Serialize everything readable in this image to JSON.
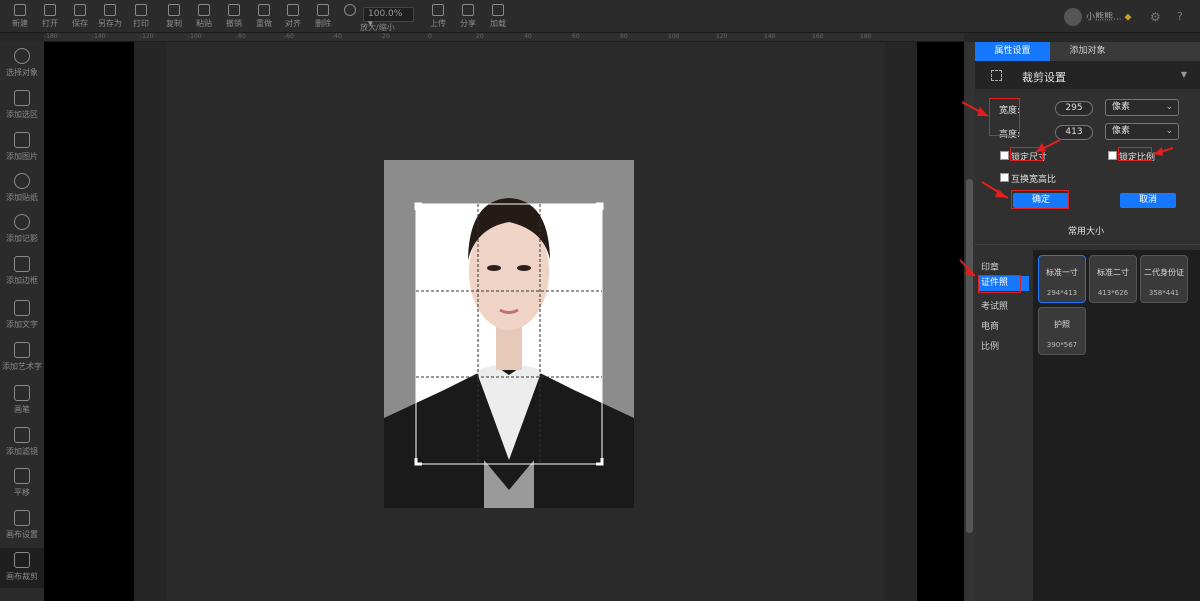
{
  "toolbar": {
    "buttons": [
      "新建",
      "打开",
      "保存",
      "另存为",
      "打印",
      "复制",
      "粘贴",
      "撤销",
      "重做",
      "对齐",
      "删除"
    ],
    "zoom_value": "100.0%",
    "zoom_label": "放大/缩小",
    "right_buttons": [
      "上传",
      "分享",
      "加载"
    ],
    "username": "小熊熊..."
  },
  "ruler": {
    "ticks": [
      "-180",
      "-140",
      "-120",
      "-100",
      "-80",
      "-60",
      "-40",
      "-20",
      "0",
      "20",
      "40",
      "60",
      "80",
      "100",
      "120",
      "140",
      "160",
      "180"
    ]
  },
  "leftbar": {
    "tools": [
      "选择对象",
      "添加选区",
      "添加图片",
      "添加贴纸",
      "添加记影",
      "添加边框",
      "添加文字",
      "添加艺术字",
      "画笔",
      "添加滤镜",
      "平移",
      "画布设置",
      "画布裁剪"
    ]
  },
  "panel": {
    "tabs": [
      "属性设置",
      "添加对象"
    ],
    "crop_title": "裁剪设置",
    "width_label": "宽度:",
    "width_value": "295",
    "height_label": "高度:",
    "height_value": "413",
    "unit_width": "像素",
    "unit_height": "像素",
    "lock_size": "锁定尺寸",
    "lock_ratio": "锁定比例",
    "swap_ratio": "互换宽高比",
    "confirm": "确定",
    "cancel": "取消",
    "common_sizes": "常用大小",
    "categories": [
      "印章",
      "证件照",
      "考试照",
      "电商",
      "比例"
    ],
    "presets": [
      {
        "name": "标准一寸",
        "size": "294*413"
      },
      {
        "name": "标准二寸",
        "size": "413*626"
      },
      {
        "name": "二代身份证",
        "size": "358*441"
      },
      {
        "name": "护照",
        "size": "390*567"
      }
    ]
  },
  "colors": {
    "accent": "#1677ff",
    "highlight": "#e02020"
  }
}
